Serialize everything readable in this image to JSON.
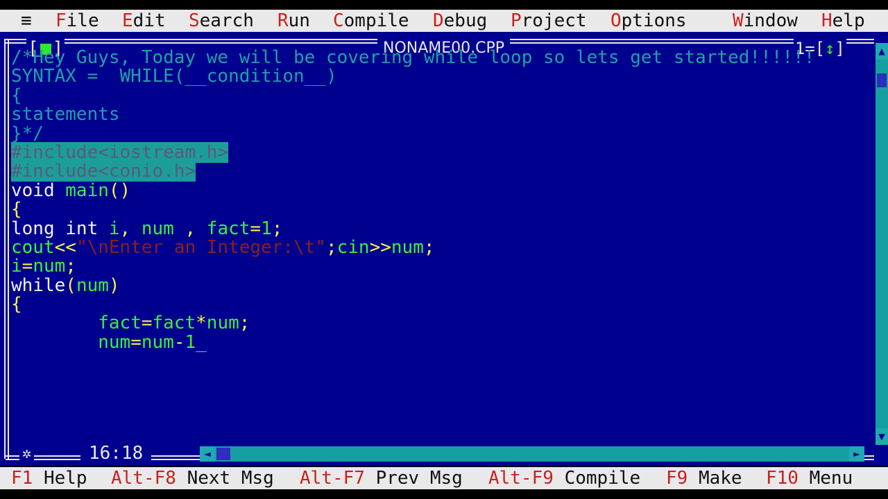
{
  "menu": [
    {
      "id": "system",
      "label": "≡",
      "hot": ""
    },
    {
      "id": "file",
      "label": "ile",
      "hot": "F"
    },
    {
      "id": "edit",
      "label": "dit",
      "hot": "E"
    },
    {
      "id": "search",
      "label": "earch",
      "hot": "S"
    },
    {
      "id": "run",
      "label": "un",
      "hot": "R"
    },
    {
      "id": "compile",
      "label": "ompile",
      "hot": "C"
    },
    {
      "id": "debug",
      "label": "ebug",
      "hot": "D"
    },
    {
      "id": "project",
      "label": "roject",
      "hot": "P"
    },
    {
      "id": "options",
      "label": "ptions",
      "hot": "O"
    },
    {
      "id": "window",
      "label": "indow",
      "hot": "W"
    },
    {
      "id": "help",
      "label": "elp",
      "hot": "H"
    }
  ],
  "window": {
    "close_left": "[",
    "close_right": "]",
    "title": "NONAME00.CPP",
    "number": "1",
    "zoom_left": "=[",
    "zoom_arrow": "↕",
    "zoom_right": "]"
  },
  "code": [
    [
      {
        "cls": "c-comment",
        "t": "/*Hey Guys, Today we will be covering while loop so lets get started!!!!!!"
      }
    ],
    [
      {
        "cls": "c-comment",
        "t": "SYNTAX =  WHILE(__condition__)"
      }
    ],
    [
      {
        "cls": "c-comment",
        "t": "{"
      }
    ],
    [
      {
        "cls": "c-comment",
        "t": "statements"
      }
    ],
    [
      {
        "cls": "c-comment",
        "t": "}*/"
      }
    ],
    [
      {
        "cls": "c-pre",
        "t": "#include<iostream.h>"
      }
    ],
    [
      {
        "cls": "c-pre",
        "t": "#include<conio.h>"
      }
    ],
    [
      {
        "cls": "c-white",
        "t": "void "
      },
      {
        "cls": "c-green",
        "t": "main"
      },
      {
        "cls": "c-yellow",
        "t": "()"
      }
    ],
    [
      {
        "cls": "c-yellow",
        "t": "{"
      }
    ],
    [
      {
        "cls": "c-white",
        "t": "long int "
      },
      {
        "cls": "c-green",
        "t": "i"
      },
      {
        "cls": "c-yellow",
        "t": ", "
      },
      {
        "cls": "c-green",
        "t": "num"
      },
      {
        "cls": "c-yellow",
        "t": " , "
      },
      {
        "cls": "c-green",
        "t": "fact"
      },
      {
        "cls": "c-yellow",
        "t": "="
      },
      {
        "cls": "c-green",
        "t": "1"
      },
      {
        "cls": "c-yellow",
        "t": ";"
      }
    ],
    [
      {
        "cls": "c-green",
        "t": "cout"
      },
      {
        "cls": "c-yellow",
        "t": "<<"
      },
      {
        "cls": "c-str",
        "t": "\"\\nEnter an Integer:\\t\""
      },
      {
        "cls": "c-yellow",
        "t": ";"
      },
      {
        "cls": "c-green",
        "t": "cin"
      },
      {
        "cls": "c-yellow",
        "t": ">>"
      },
      {
        "cls": "c-green",
        "t": "num"
      },
      {
        "cls": "c-yellow",
        "t": ";"
      }
    ],
    [
      {
        "cls": "c-green",
        "t": "i"
      },
      {
        "cls": "c-yellow",
        "t": "="
      },
      {
        "cls": "c-green",
        "t": "num"
      },
      {
        "cls": "c-yellow",
        "t": ";"
      }
    ],
    [
      {
        "cls": "c-white",
        "t": "while"
      },
      {
        "cls": "c-yellow",
        "t": "("
      },
      {
        "cls": "c-green",
        "t": "num"
      },
      {
        "cls": "c-yellow",
        "t": ")"
      }
    ],
    [
      {
        "cls": "c-yellow",
        "t": "{"
      }
    ],
    [
      {
        "cls": "c-white",
        "t": "        "
      },
      {
        "cls": "c-green",
        "t": "fact"
      },
      {
        "cls": "c-yellow",
        "t": "="
      },
      {
        "cls": "c-green",
        "t": "fact"
      },
      {
        "cls": "c-yellow",
        "t": "*"
      },
      {
        "cls": "c-green",
        "t": "num"
      },
      {
        "cls": "c-yellow",
        "t": ";"
      }
    ],
    [
      {
        "cls": "c-white",
        "t": "        "
      },
      {
        "cls": "c-green",
        "t": "num"
      },
      {
        "cls": "c-yellow",
        "t": "="
      },
      {
        "cls": "c-green",
        "t": "num"
      },
      {
        "cls": "c-yellow",
        "t": "-"
      },
      {
        "cls": "c-green",
        "t": "1"
      },
      {
        "cls": "c-green",
        "t": "_"
      }
    ]
  ],
  "status": {
    "cursor": "16:18"
  },
  "shortcuts": [
    {
      "key": "F1",
      "label": " Help"
    },
    {
      "key": "Alt-F8",
      "label": " Next Msg"
    },
    {
      "key": "Alt-F7",
      "label": " Prev Msg"
    },
    {
      "key": "Alt-F9",
      "label": " Compile"
    },
    {
      "key": "F9",
      "label": " Make"
    },
    {
      "key": "F10",
      "label": " Menu"
    }
  ],
  "colors": {
    "background": "#00008f",
    "menu_bg": "#e9e9e9",
    "hotkey": "#c8221e",
    "comment": "#1fa1a6",
    "keyword": "#f2f2f2",
    "identifier": "#3bf03b",
    "symbol": "#f6f34a",
    "string": "#8a1f1f"
  }
}
